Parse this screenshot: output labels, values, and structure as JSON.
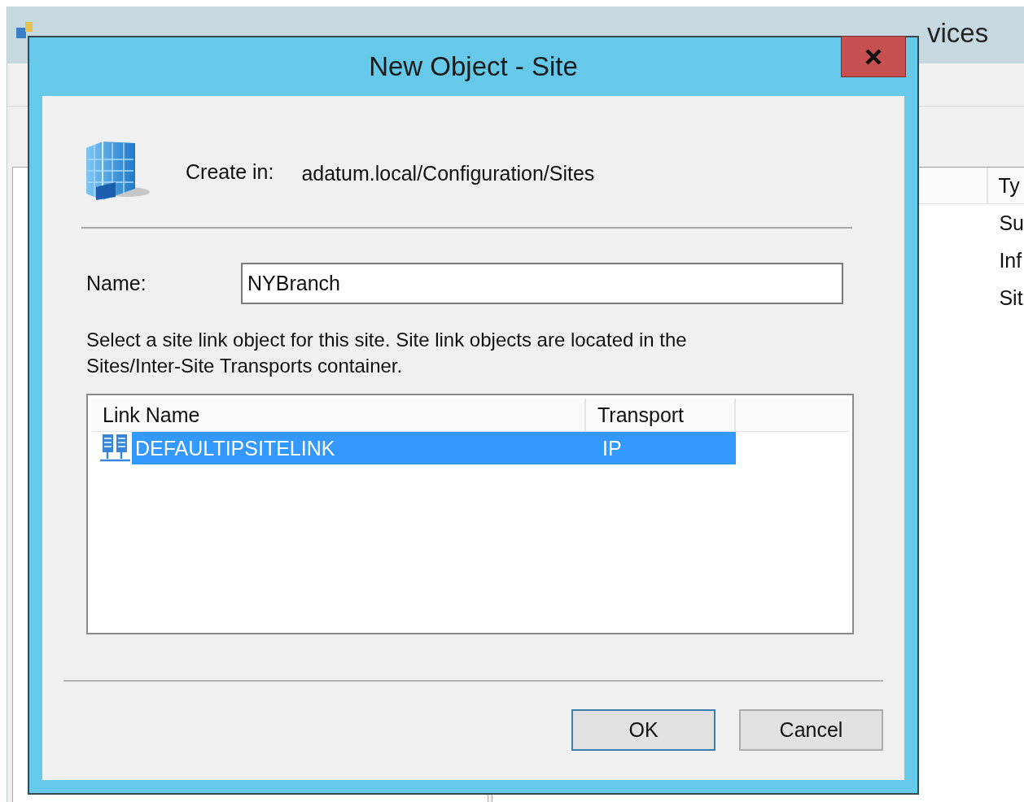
{
  "background_window": {
    "title": "vices",
    "list_header": {
      "column_2": "Ty"
    },
    "rows": [
      {
        "column_2": "Su"
      },
      {
        "column_2": "Inf"
      },
      {
        "column_2": "Sit"
      }
    ]
  },
  "dialog": {
    "title": "New Object - Site",
    "create_in_label": "Create in:",
    "create_in_path": "adatum.local/Configuration/Sites",
    "name_label": "Name:",
    "name_value": "NYBranch",
    "instruction": "Select a site link object for this site. Site link objects are located in the Sites/Inter-Site Transports container.",
    "site_links": {
      "columns": [
        "Link Name",
        "Transport"
      ],
      "rows": [
        {
          "link_name": "DEFAULTIPSITELINK",
          "transport": "IP",
          "selected": true
        }
      ]
    },
    "buttons": [
      {
        "label": "OK",
        "default": true
      },
      {
        "label": "Cancel",
        "default": false
      }
    ]
  }
}
